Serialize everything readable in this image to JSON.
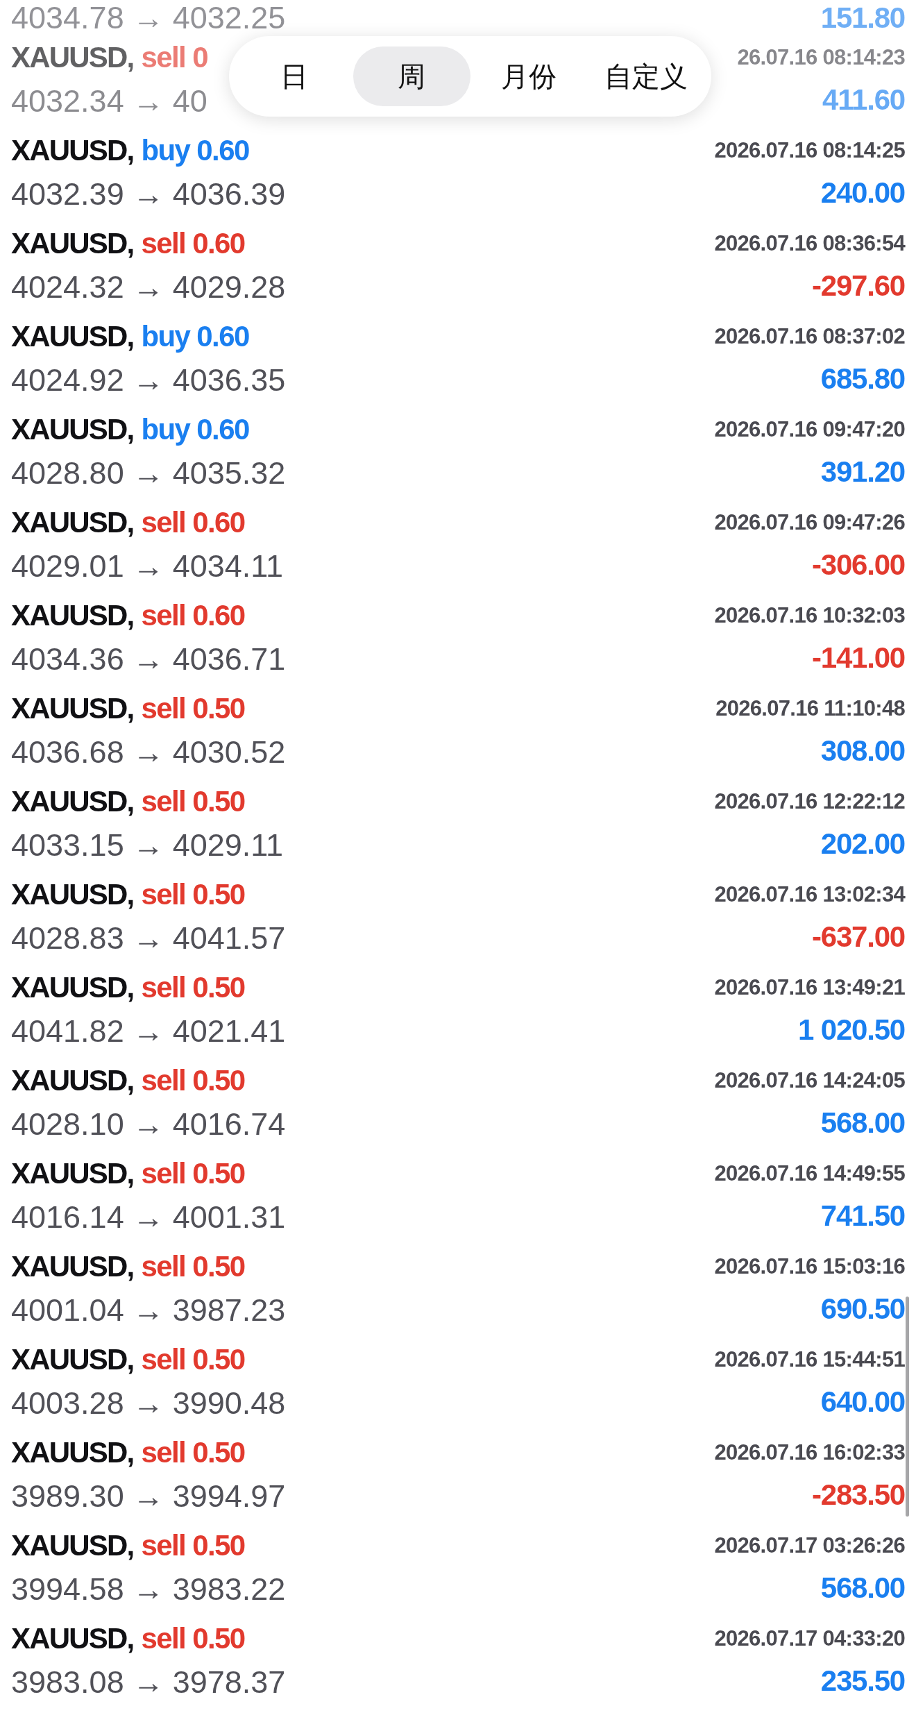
{
  "period_tabs": [
    {
      "label": "日",
      "selected": false
    },
    {
      "label": "周",
      "selected": true
    },
    {
      "label": "月份",
      "selected": false
    },
    {
      "label": "自定义",
      "selected": false
    }
  ],
  "trades": [
    {
      "prices": "4034.78 → 4032.25",
      "profit": "151.80",
      "loss": false
    },
    {
      "kind": "sell",
      "symbol": "XAUUSD,",
      "order": "sell 0",
      "time": "26.07.16 08:14:23",
      "prices": "4032.34 → 40",
      "profit": "411.60",
      "loss": false
    },
    {
      "kind": "buy",
      "symbol": "XAUUSD,",
      "order": "buy 0.60",
      "time": "2026.07.16 08:14:25",
      "prices": "4032.39 → 4036.39",
      "profit": "240.00",
      "loss": false
    },
    {
      "kind": "sell",
      "symbol": "XAUUSD,",
      "order": "sell 0.60",
      "time": "2026.07.16 08:36:54",
      "prices": "4024.32 → 4029.28",
      "profit": "-297.60",
      "loss": true
    },
    {
      "kind": "buy",
      "symbol": "XAUUSD,",
      "order": "buy 0.60",
      "time": "2026.07.16 08:37:02",
      "prices": "4024.92 → 4036.35",
      "profit": "685.80",
      "loss": false
    },
    {
      "kind": "buy",
      "symbol": "XAUUSD,",
      "order": "buy 0.60",
      "time": "2026.07.16 09:47:20",
      "prices": "4028.80 → 4035.32",
      "profit": "391.20",
      "loss": false
    },
    {
      "kind": "sell",
      "symbol": "XAUUSD,",
      "order": "sell 0.60",
      "time": "2026.07.16 09:47:26",
      "prices": "4029.01 → 4034.11",
      "profit": "-306.00",
      "loss": true
    },
    {
      "kind": "sell",
      "symbol": "XAUUSD,",
      "order": "sell 0.60",
      "time": "2026.07.16 10:32:03",
      "prices": "4034.36 → 4036.71",
      "profit": "-141.00",
      "loss": true
    },
    {
      "kind": "sell",
      "symbol": "XAUUSD,",
      "order": "sell 0.50",
      "time": "2026.07.16 11:10:48",
      "prices": "4036.68 → 4030.52",
      "profit": "308.00",
      "loss": false
    },
    {
      "kind": "sell",
      "symbol": "XAUUSD,",
      "order": "sell 0.50",
      "time": "2026.07.16 12:22:12",
      "prices": "4033.15 → 4029.11",
      "profit": "202.00",
      "loss": false
    },
    {
      "kind": "sell",
      "symbol": "XAUUSD,",
      "order": "sell 0.50",
      "time": "2026.07.16 13:02:34",
      "prices": "4028.83 → 4041.57",
      "profit": "-637.00",
      "loss": true
    },
    {
      "kind": "sell",
      "symbol": "XAUUSD,",
      "order": "sell 0.50",
      "time": "2026.07.16 13:49:21",
      "prices": "4041.82 → 4021.41",
      "profit": "1 020.50",
      "loss": false
    },
    {
      "kind": "sell",
      "symbol": "XAUUSD,",
      "order": "sell 0.50",
      "time": "2026.07.16 14:24:05",
      "prices": "4028.10 → 4016.74",
      "profit": "568.00",
      "loss": false
    },
    {
      "kind": "sell",
      "symbol": "XAUUSD,",
      "order": "sell 0.50",
      "time": "2026.07.16 14:49:55",
      "prices": "4016.14 → 4001.31",
      "profit": "741.50",
      "loss": false
    },
    {
      "kind": "sell",
      "symbol": "XAUUSD,",
      "order": "sell 0.50",
      "time": "2026.07.16 15:03:16",
      "prices": "4001.04 → 3987.23",
      "profit": "690.50",
      "loss": false
    },
    {
      "kind": "sell",
      "symbol": "XAUUSD,",
      "order": "sell 0.50",
      "time": "2026.07.16 15:44:51",
      "prices": "4003.28 → 3990.48",
      "profit": "640.00",
      "loss": false
    },
    {
      "kind": "sell",
      "symbol": "XAUUSD,",
      "order": "sell 0.50",
      "time": "2026.07.16 16:02:33",
      "prices": "3989.30 → 3994.97",
      "profit": "-283.50",
      "loss": true
    },
    {
      "kind": "sell",
      "symbol": "XAUUSD,",
      "order": "sell 0.50",
      "time": "2026.07.17 03:26:26",
      "prices": "3994.58 → 3983.22",
      "profit": "568.00",
      "loss": false
    },
    {
      "kind": "sell",
      "symbol": "XAUUSD,",
      "order": "sell 0.50",
      "time": "2026.07.17 04:33:20",
      "prices": "3983.08 → 3978.37",
      "profit": "235.50",
      "loss": false
    }
  ]
}
